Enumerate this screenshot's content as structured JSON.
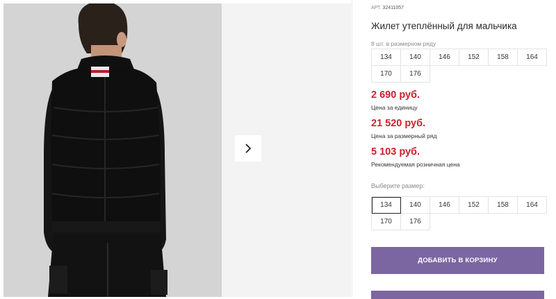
{
  "product": {
    "article_label": "АРТ.",
    "article_number": "32411057",
    "title": "Жилет утеплённый для мальчика",
    "pack_note": "8 шт. в размерном ряду",
    "pack_sizes": [
      "134",
      "140",
      "146",
      "152",
      "158",
      "164",
      "170",
      "176"
    ]
  },
  "prices": [
    {
      "value": "2 690 руб.",
      "label": "Цена за единицу"
    },
    {
      "value": "21 520 руб.",
      "label": "Цена за размерный ряд"
    },
    {
      "value": "5 103 руб.",
      "label": "Рекомендуемая розничная цена"
    }
  ],
  "size_select": {
    "label": "Выберите размер:",
    "options": [
      "134",
      "140",
      "146",
      "152",
      "158",
      "164",
      "170",
      "176"
    ],
    "selected": "134"
  },
  "actions": {
    "add_to_cart": "ДОБАВИТЬ В КОРЗИНУ"
  },
  "gallery": {
    "next_icon": "chevron-right-icon",
    "photo_description_icon": "product-photo"
  },
  "colors": {
    "accent": "#7c66a1",
    "price": "#cf1f2e",
    "photo_bg": "#d3d3d3",
    "next_slide_bg": "#f3f3f3"
  }
}
